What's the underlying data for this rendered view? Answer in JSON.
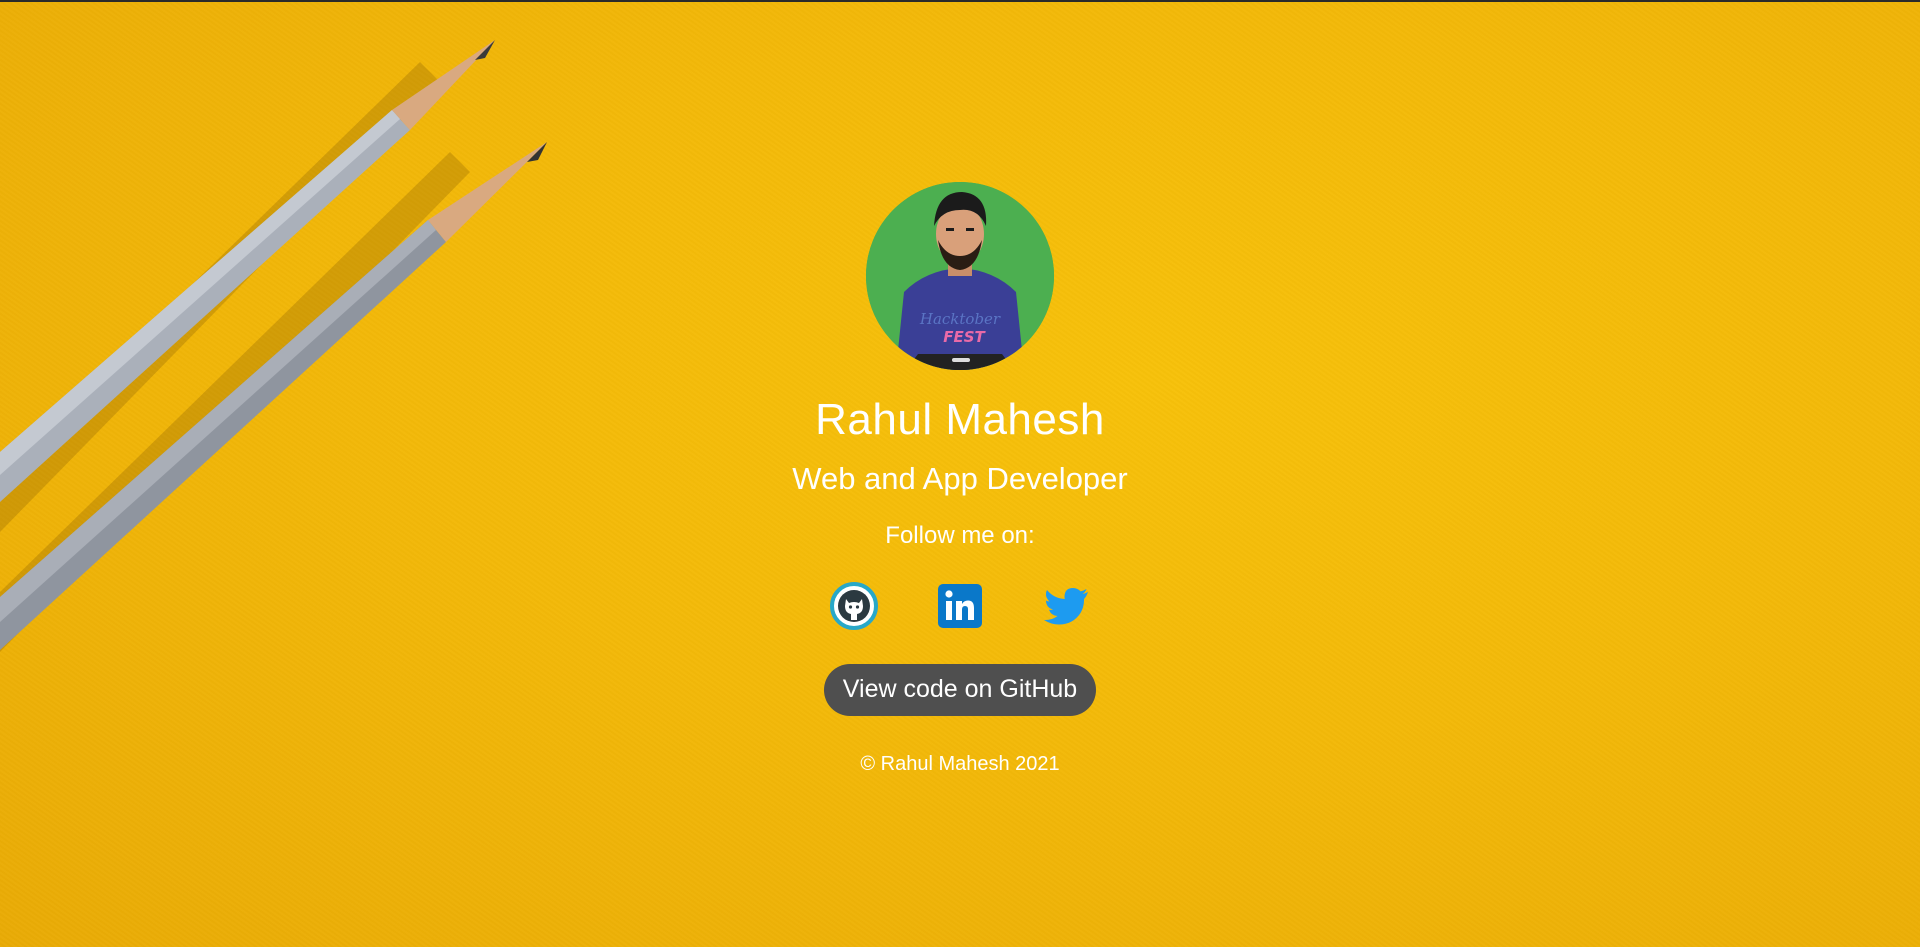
{
  "profile": {
    "name": "Rahul Mahesh",
    "role": "Web and App Developer",
    "avatar_shirt_text_1": "Hacktober",
    "avatar_shirt_text_2": "FEST"
  },
  "social": {
    "heading": "Follow me on:",
    "links": [
      {
        "icon": "github-icon"
      },
      {
        "icon": "linkedin-icon"
      },
      {
        "icon": "twitter-icon"
      }
    ]
  },
  "actions": {
    "view_code_label": "View code on GitHub"
  },
  "footer": {
    "copyright": "© Rahul Mahesh 2021"
  },
  "colors": {
    "background": "#f3b909",
    "button": "#4f4f4f",
    "text": "#ffffff",
    "avatar_bg": "#4caf50",
    "linkedin": "#0a78c9",
    "twitter": "#1d9bf0",
    "github_ring": "#28a8c8"
  }
}
